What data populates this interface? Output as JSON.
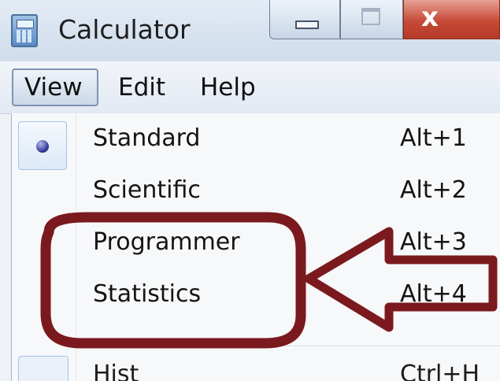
{
  "window": {
    "title": "Calculator",
    "close_glyph": "x"
  },
  "menubar": {
    "items": [
      {
        "label": "View",
        "active": true
      },
      {
        "label": "Edit",
        "active": false
      },
      {
        "label": "Help",
        "active": false
      }
    ]
  },
  "view_menu": {
    "items": [
      {
        "label": "Standard",
        "shortcut": "Alt+1",
        "selected": true
      },
      {
        "label": "Scientific",
        "shortcut": "Alt+2",
        "selected": false
      },
      {
        "label": "Programmer",
        "shortcut": "Alt+3",
        "selected": false
      },
      {
        "label": "Statistics",
        "shortcut": "Alt+4",
        "selected": false
      }
    ],
    "partial_item": {
      "label": "Hist",
      "shortcut": "Ctrl+H"
    }
  },
  "annotation": {
    "color": "#7b1a1e",
    "highlighted_items": [
      "Programmer",
      "Statistics"
    ],
    "arrow_direction": "left"
  },
  "colors": {
    "close_button": "#c74a37",
    "radio_dot": "#2a2f8e",
    "menu_background": "#f7f8fa"
  }
}
